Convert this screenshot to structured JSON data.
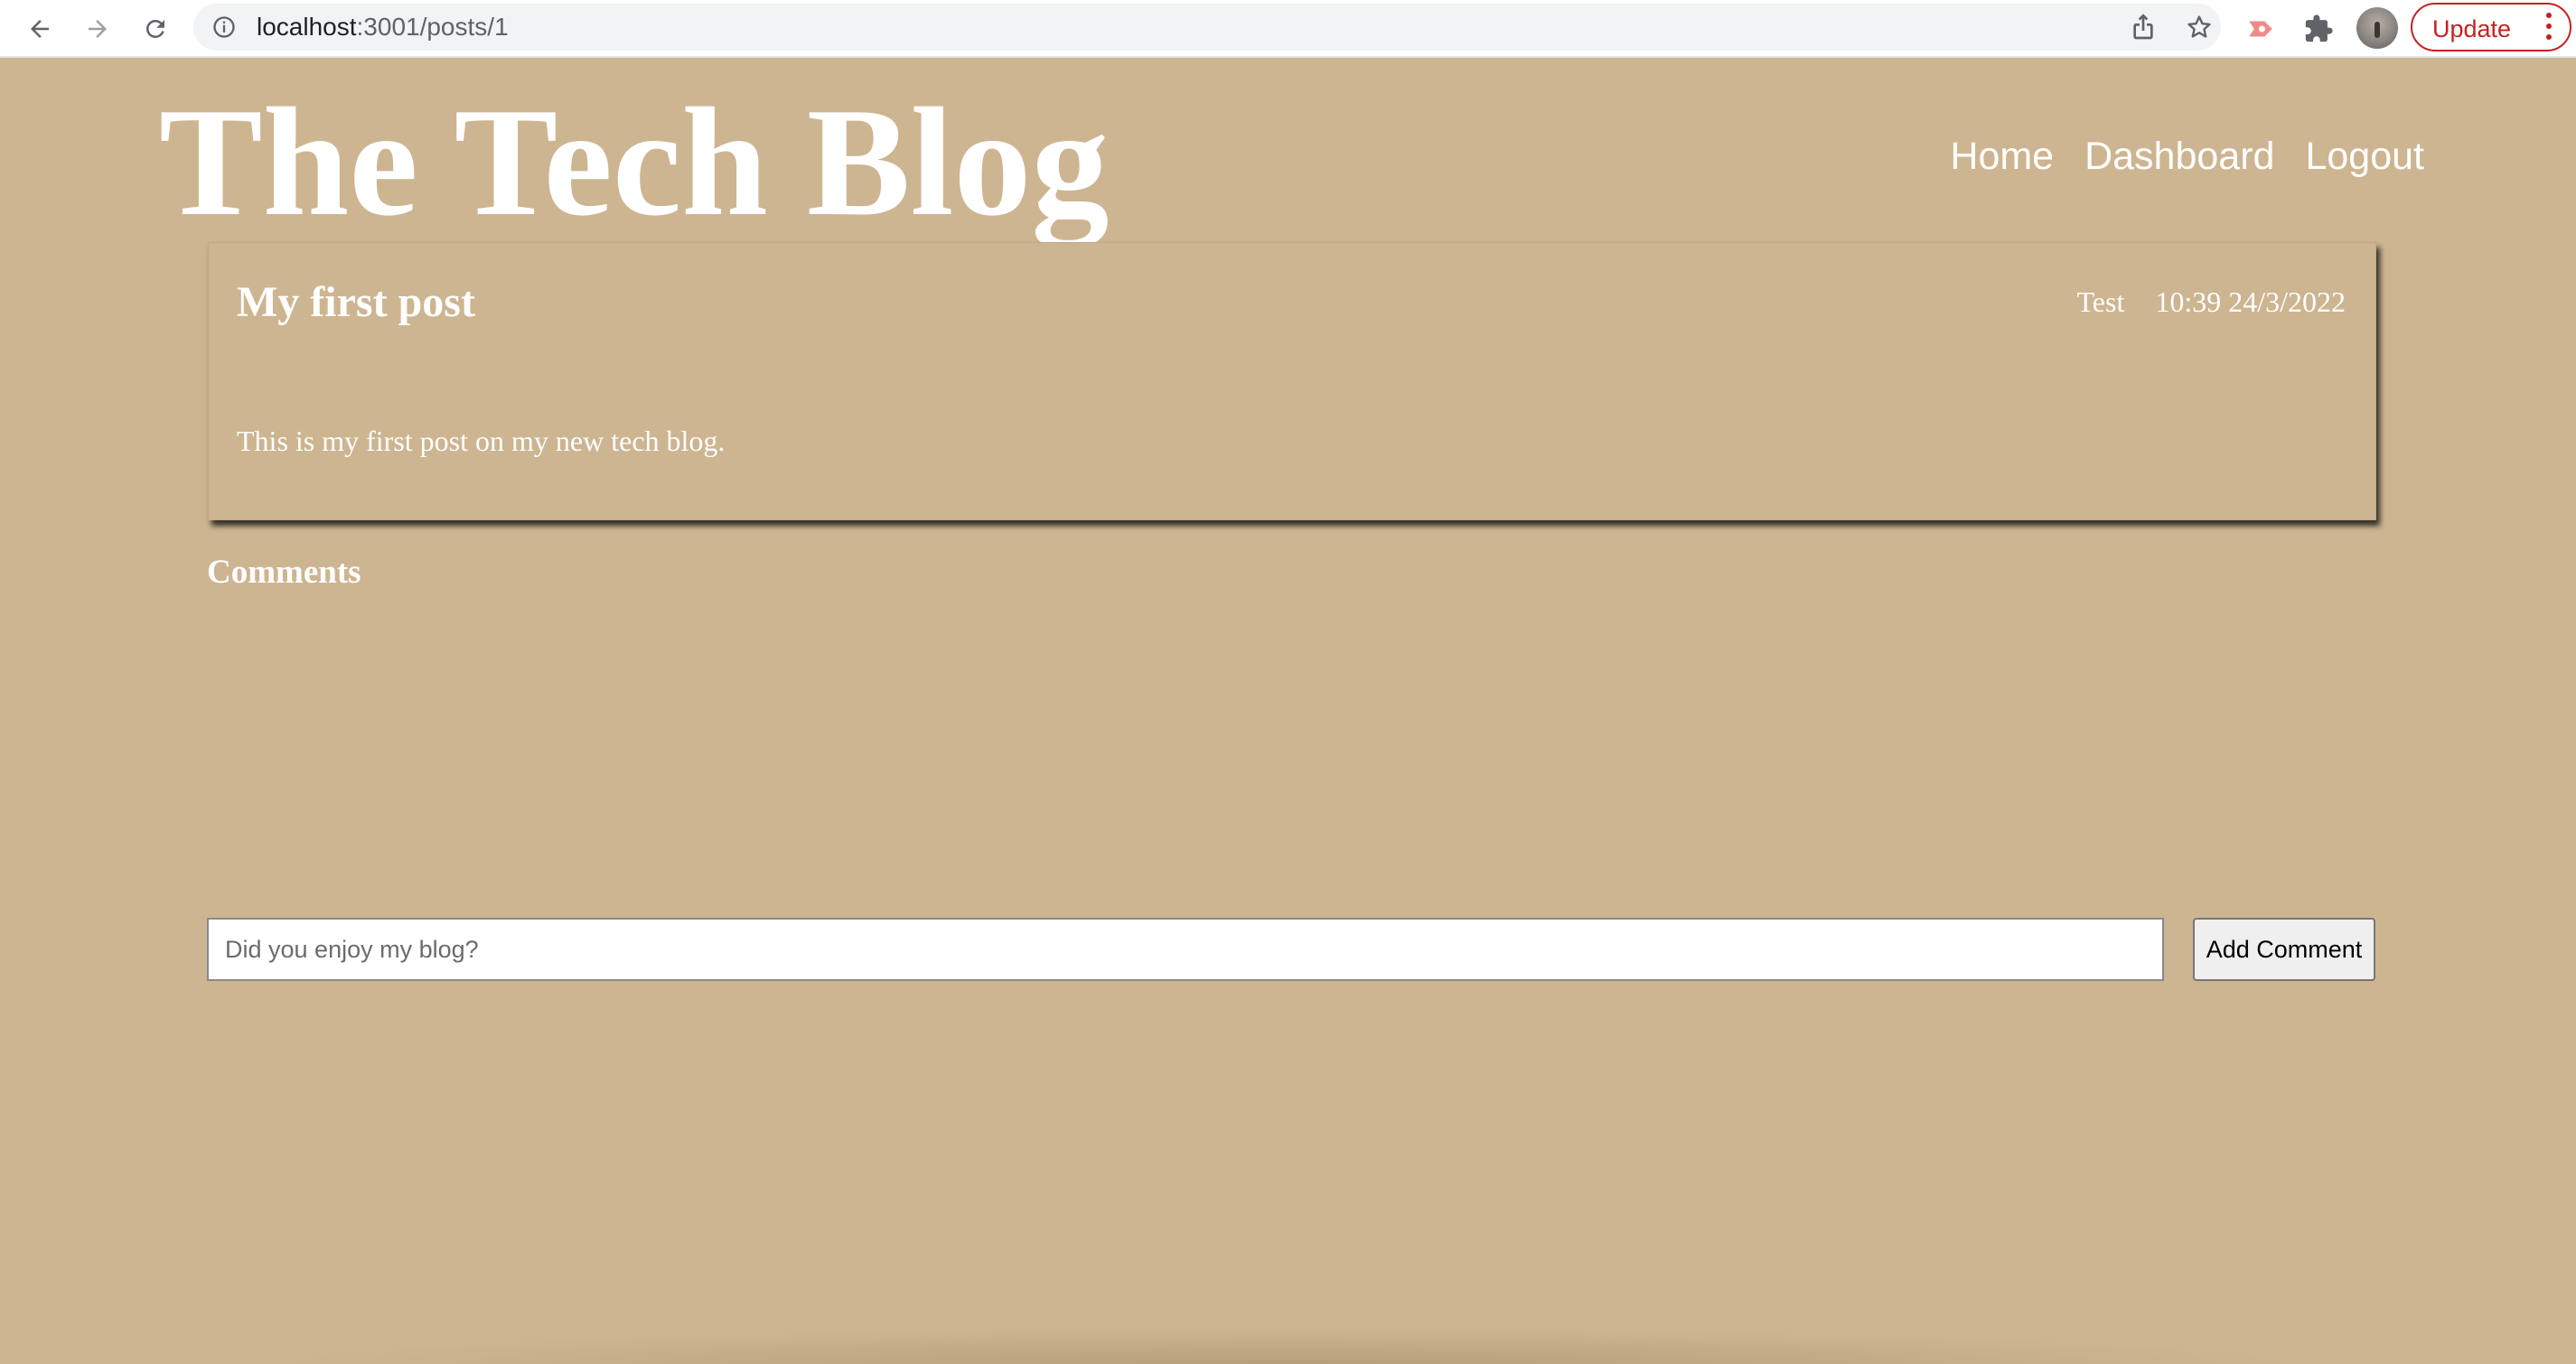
{
  "browser": {
    "url_host": "localhost",
    "url_rest": ":3001/posts/1",
    "update_label": "Update"
  },
  "site": {
    "title": "The Tech Blog",
    "nav": [
      "Home",
      "Dashboard",
      "Logout"
    ]
  },
  "post": {
    "title": "My first post",
    "author": "Test",
    "date": "10:39 24/3/2022",
    "body": "This is my first post on my new tech blog."
  },
  "comments": {
    "heading": "Comments",
    "input_placeholder": "Did you enjoy my blog?",
    "add_label": "Add Comment"
  },
  "colors": {
    "page_background": "#cdb591",
    "text": "#ffffff",
    "update_accent": "#c5221f"
  }
}
